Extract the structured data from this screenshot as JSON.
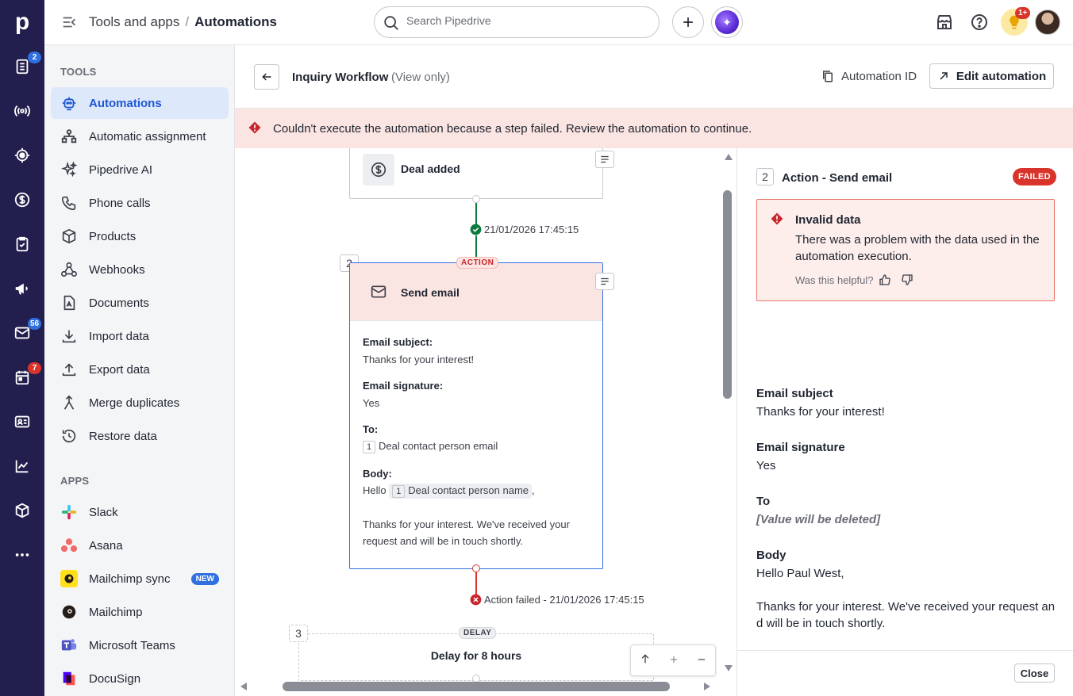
{
  "rail": {
    "logo": "p",
    "items": [
      {
        "icon": "deals-icon",
        "badge": "2",
        "badge_color": "#2f6fe0"
      },
      {
        "icon": "broadcast-icon",
        "badge": null
      },
      {
        "icon": "target-icon",
        "badge": null
      },
      {
        "icon": "dollar-icon",
        "badge": null
      },
      {
        "icon": "clipboard-icon",
        "badge": null
      },
      {
        "icon": "megaphone-icon",
        "badge": null
      },
      {
        "icon": "mail-icon",
        "badge": "56",
        "badge_color": "#2f6fe0"
      },
      {
        "icon": "calendar-icon",
        "badge": "7",
        "badge_color": "#d9342b"
      },
      {
        "icon": "contacts-icon",
        "badge": null
      },
      {
        "icon": "chart-icon",
        "badge": null
      },
      {
        "icon": "box-icon",
        "badge": null
      },
      {
        "icon": "more-icon",
        "badge": null
      }
    ]
  },
  "topbar": {
    "breadcrumb_parent": "Tools and apps",
    "breadcrumb_sep": "/",
    "breadcrumb_current": "Automations",
    "search_placeholder": "Search Pipedrive",
    "notification_badge": "1+"
  },
  "sidebar": {
    "tools_title": "TOOLS",
    "tools": [
      {
        "label": "Automations",
        "icon": "robot-icon",
        "active": true
      },
      {
        "label": "Automatic assignment",
        "icon": "assignment-icon"
      },
      {
        "label": "Pipedrive AI",
        "icon": "sparkle-icon"
      },
      {
        "label": "Phone calls",
        "icon": "phone-icon"
      },
      {
        "label": "Products",
        "icon": "cube-icon"
      },
      {
        "label": "Webhooks",
        "icon": "webhook-icon"
      },
      {
        "label": "Documents",
        "icon": "document-icon"
      },
      {
        "label": "Import data",
        "icon": "download-icon"
      },
      {
        "label": "Export data",
        "icon": "upload-icon"
      },
      {
        "label": "Merge duplicates",
        "icon": "merge-icon"
      },
      {
        "label": "Restore data",
        "icon": "history-icon"
      }
    ],
    "apps_title": "APPS",
    "apps": [
      {
        "label": "Slack",
        "icon": "slack-icon"
      },
      {
        "label": "Asana",
        "icon": "asana-icon"
      },
      {
        "label": "Mailchimp sync",
        "icon": "mailchimp-icon",
        "badge": "NEW"
      },
      {
        "label": "Mailchimp",
        "icon": "mailchimp-icon"
      },
      {
        "label": "Microsoft Teams",
        "icon": "teams-icon"
      },
      {
        "label": "DocuSign",
        "icon": "docusign-icon"
      }
    ]
  },
  "header": {
    "title": "Inquiry Workflow",
    "subtitle": "(View only)",
    "automation_id": "Automation ID",
    "edit_button": "Edit automation"
  },
  "error_banner": "Couldn't execute the automation because a step failed. Review the automation to continue.",
  "workflow": {
    "trigger": {
      "title": "Deal added"
    },
    "trigger_status": "21/01/2026 17:45:15",
    "action": {
      "number": "2",
      "pill": "ACTION",
      "title": "Send email",
      "fields": {
        "subject_label": "Email subject:",
        "subject_value": "Thanks for your interest!",
        "signature_label": "Email signature:",
        "signature_value": "Yes",
        "to_label": "To:",
        "to_num": "1",
        "to_value": "Deal contact person email",
        "body_label": "Body:",
        "body_prefix": "Hello",
        "body_num": "1",
        "body_token": "Deal contact person name",
        "body_suffix": ",",
        "body_text": "Thanks for your interest. We've received your request and will be in touch shortly."
      }
    },
    "action_status": "Action failed - 21/01/2026 17:45:15",
    "delay": {
      "number": "3",
      "pill": "DELAY",
      "title": "Delay for 8 hours"
    }
  },
  "detail": {
    "step_number": "2",
    "step_title": "Action - Send email",
    "status": "FAILED",
    "error_title": "Invalid data",
    "error_text": "There was a problem with the data used in the automation execution.",
    "helpful": "Was this helpful?",
    "fields": [
      {
        "label": "Email subject",
        "value": "Thanks for your interest!",
        "italic": false
      },
      {
        "label": "Email signature",
        "value": "Yes",
        "italic": false
      },
      {
        "label": "To",
        "value": "[Value will be deleted]",
        "italic": true
      },
      {
        "label": "Body",
        "value": "Hello Paul West,",
        "italic": false
      }
    ],
    "body_paragraph": "Thanks for your interest. We've received your request an d will be in touch shortly.",
    "close": "Close"
  },
  "colors": {
    "accent": "#1f57d1",
    "rail": "#221e4d",
    "error": "#d9342b",
    "success": "#0b7a3e",
    "error_bg": "#fbe5e2"
  }
}
